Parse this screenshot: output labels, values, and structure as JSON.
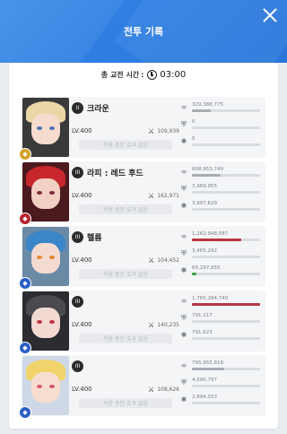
{
  "header": {
    "title": "전투 기록"
  },
  "summary": {
    "label": "총 교전 시간",
    "colon": ":",
    "time": "03:00"
  },
  "colors": {
    "header_blue": "#3a8ae8",
    "damage_red": "#b8373f",
    "shield_blue": "#3e6db5",
    "heal_green": "#3aa04a",
    "bar_gray": "#a8acb4"
  },
  "units": [
    {
      "name": "크라운",
      "burst": "II",
      "level": "LV.400",
      "combat_power": "109,939",
      "effect": "적용 중인 효과 없음",
      "element_icon": "fire-element-icon",
      "element_color": "#d3a12a",
      "portrait": {
        "skin": "#f6dccf",
        "hair": "#ead7a8",
        "eye": "#4a6fb3",
        "bg": "#3a3a3a"
      },
      "stats": [
        {
          "label": "329,388,775",
          "kind": "damage",
          "ratio": 0.28,
          "color": "#a8acb4"
        },
        {
          "label": "0",
          "kind": "shield",
          "ratio": 0,
          "color": "#a8acb4"
        },
        {
          "label": "0",
          "kind": "heal",
          "ratio": 0,
          "color": "#a8acb4"
        }
      ]
    },
    {
      "name": "라피 : 레드 후드",
      "burst": "III",
      "level": "LV.400",
      "combat_power": "162,971",
      "effect": "적용 중인 효과 없음",
      "element_icon": "fire-element-icon",
      "element_color": "#b8242c",
      "portrait": {
        "skin": "#f2d0c4",
        "hair": "#c8262d",
        "eye": "#7d2a3a",
        "bg": "#4a1a1f"
      },
      "stats": [
        {
          "label": "608,953,749",
          "kind": "damage",
          "ratio": 0.42,
          "color": "#a8acb4"
        },
        {
          "label": "3,969,955",
          "kind": "shield",
          "ratio": 0.0,
          "color": "#a8acb4"
        },
        {
          "label": "3,997,629",
          "kind": "heal",
          "ratio": 0.0,
          "color": "#a8acb4"
        }
      ]
    },
    {
      "name": "헬름",
      "burst": "III",
      "level": "LV.400",
      "combat_power": "104,452",
      "effect": "적용 중인 효과 없음",
      "element_icon": "water-element-icon",
      "element_color": "#2a5fc7",
      "portrait": {
        "skin": "#f4dbd2",
        "hair": "#3b86c9",
        "eye": "#e2892a",
        "bg": "#6a8aa6"
      },
      "stats": [
        {
          "label": "1,262,948,587",
          "kind": "damage",
          "ratio": 0.72,
          "color": "#b8373f"
        },
        {
          "label": "3,465,292",
          "kind": "shield",
          "ratio": 0.0,
          "color": "#a8acb4"
        },
        {
          "label": "65,297,955",
          "kind": "heal",
          "ratio": 0.06,
          "color": "#3aa04a"
        }
      ]
    },
    {
      "name": "",
      "burst": "III",
      "level": "LV.400",
      "combat_power": "140,235",
      "effect": "적용 중인 효과 없음",
      "element_icon": "water-element-icon",
      "element_color": "#2a5fc7",
      "portrait": {
        "skin": "#f2dad2",
        "hair": "#4a4a4f",
        "eye": "#c13040",
        "bg": "#2b2b30"
      },
      "stats": [
        {
          "label": "1,765,284,740",
          "kind": "damage",
          "ratio": 1.0,
          "color": "#b8373f"
        },
        {
          "label": "791,117",
          "kind": "shield",
          "ratio": 0.0,
          "color": "#a8acb4"
        },
        {
          "label": "791,623",
          "kind": "heal",
          "ratio": 0.0,
          "color": "#a8acb4"
        }
      ]
    },
    {
      "name": "",
      "burst": "III",
      "level": "LV.400",
      "combat_power": "108,626",
      "effect": "적용 중인 효과 없음",
      "element_icon": "water-element-icon",
      "element_color": "#2a5fc7",
      "portrait": {
        "skin": "#f7ddd0",
        "hair": "#f0d36a",
        "eye": "#d8566a",
        "bg": "#cfd8e6"
      },
      "stats": [
        {
          "label": "795,955,818",
          "kind": "damage",
          "ratio": 0.47,
          "color": "#a8acb4"
        },
        {
          "label": "4,590,797",
          "kind": "shield",
          "ratio": 0.0,
          "color": "#3e6db5"
        },
        {
          "label": "2,894,033",
          "kind": "heal",
          "ratio": 0.0,
          "color": "#a8acb4"
        }
      ]
    }
  ]
}
